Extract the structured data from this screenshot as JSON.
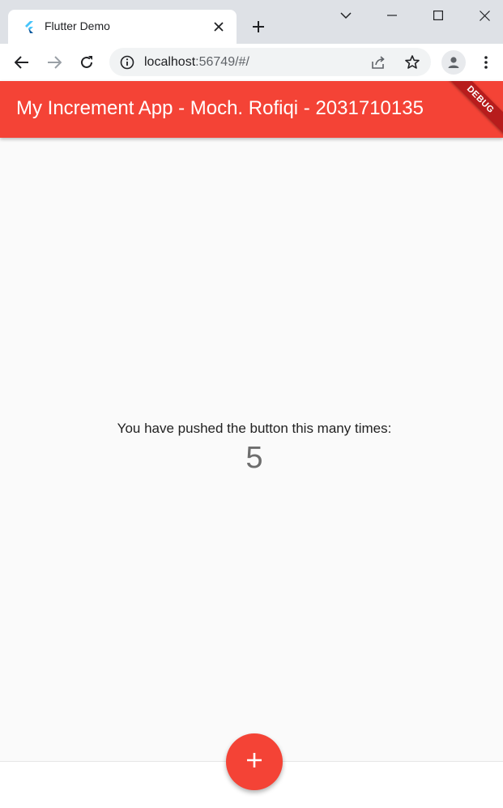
{
  "browser": {
    "tab_title": "Flutter Demo",
    "url_host": "localhost",
    "url_rest": ":56749/#/"
  },
  "app": {
    "title": "My Increment App - Moch. Rofiqi - 2031710135",
    "debug_banner": "DEBUG",
    "primary_color": "#f44336"
  },
  "counter": {
    "label": "You have pushed the button this many times:",
    "value": "5"
  },
  "icons": {
    "favicon": "flutter-logo-icon",
    "fab": "add-icon"
  }
}
